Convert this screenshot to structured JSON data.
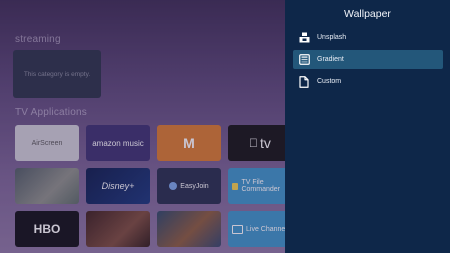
{
  "background": {
    "streaming_title": "streaming",
    "empty_message": "This category is empty.",
    "tv_apps_title": "TV Applications",
    "tiles": [
      {
        "label": "AirScreen"
      },
      {
        "label": "amazon music"
      },
      {
        "label": "M"
      },
      {
        "label": "tv"
      },
      {
        "label": ""
      },
      {
        "label": "Disney+"
      },
      {
        "label": "EasyJoin"
      },
      {
        "label": "TV File Commander"
      },
      {
        "label": "HBO"
      },
      {
        "label": ""
      },
      {
        "label": ""
      },
      {
        "label": "Live Channels"
      }
    ]
  },
  "panel": {
    "title": "Wallpaper",
    "items": [
      {
        "label": "Unsplash",
        "icon": "unsplash-icon",
        "selected": false
      },
      {
        "label": "Gradient",
        "icon": "gradient-icon",
        "selected": true
      },
      {
        "label": "Custom",
        "icon": "file-icon",
        "selected": false
      }
    ]
  },
  "colors": {
    "panel_bg": "#0e2749",
    "selected_bg": "#23577a"
  }
}
